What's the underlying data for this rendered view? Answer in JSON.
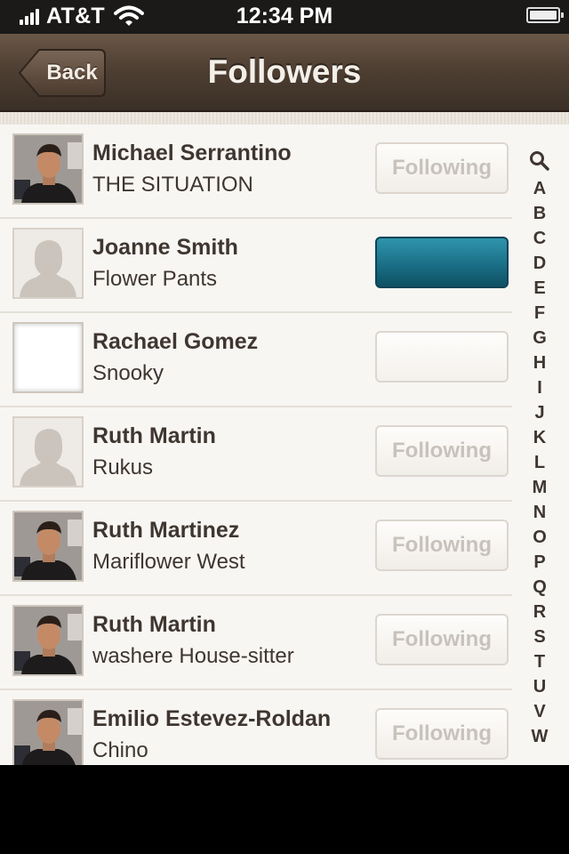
{
  "status_bar": {
    "carrier": "AT&T",
    "time": "12:34 PM"
  },
  "nav": {
    "back_label": "Back",
    "title": "Followers"
  },
  "followers": [
    {
      "name": "Michael Serrantino",
      "subtitle": "THE SITUATION",
      "avatar": "photo",
      "button_label": "Following",
      "button_style": "following"
    },
    {
      "name": "Joanne Smith",
      "subtitle": "Flower Pants",
      "avatar": "silhouette",
      "button_label": "",
      "button_style": "blue"
    },
    {
      "name": "Rachael Gomez",
      "subtitle": "Snooky",
      "avatar": "empty",
      "button_label": "",
      "button_style": "blank"
    },
    {
      "name": "Ruth Martin",
      "subtitle": "Rukus",
      "avatar": "silhouette",
      "button_label": "Following",
      "button_style": "following"
    },
    {
      "name": "Ruth Martinez",
      "subtitle": "Mariflower West",
      "avatar": "photo",
      "button_label": "Following",
      "button_style": "following"
    },
    {
      "name": "Ruth Martin",
      "subtitle": "washere House-sitter",
      "avatar": "photo",
      "button_label": "Following",
      "button_style": "following"
    },
    {
      "name": "Emilio Estevez-Roldan",
      "subtitle": "Chino",
      "avatar": "photo",
      "button_label": "Following",
      "button_style": "following"
    }
  ],
  "index_letters": [
    "A",
    "B",
    "C",
    "D",
    "E",
    "F",
    "G",
    "H",
    "I",
    "J",
    "K",
    "L",
    "M",
    "N",
    "O",
    "P",
    "Q",
    "R",
    "S",
    "T",
    "U",
    "V",
    "W"
  ],
  "colors": {
    "accent_blue": "#1a6f86",
    "nav_brown": "#4e3f32",
    "text": "#3f3630"
  }
}
